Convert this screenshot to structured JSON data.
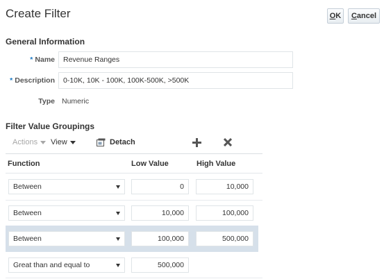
{
  "header": {
    "title": "Create Filter",
    "ok_label": "OK",
    "ok_rest": "K",
    "ok_mnemonic": "O",
    "cancel_mnemonic": "C",
    "cancel_rest": "ancel"
  },
  "general": {
    "section_title": "General Information",
    "name_label": "Name",
    "name_value": "Revenue Ranges",
    "description_label": "Description",
    "description_value": "0-10K, 10K - 100K, 100K-500K, >500K",
    "type_label": "Type",
    "type_value": "Numeric"
  },
  "groupings": {
    "section_title": "Filter Value Groupings",
    "toolbar": {
      "actions_label": "Actions",
      "view_label": "View",
      "detach_label": "Detach"
    },
    "columns": [
      "Function",
      "Low Value",
      "High Value"
    ],
    "rows": [
      {
        "function": "Between",
        "low": "0",
        "high": "10,000",
        "selected": false
      },
      {
        "function": "Between",
        "low": "10,000",
        "high": "100,000",
        "selected": false
      },
      {
        "function": "Between",
        "low": "100,000",
        "high": "500,000",
        "selected": true
      },
      {
        "function": "Great than and equal to",
        "low": "500,000",
        "high": "",
        "selected": false
      }
    ]
  },
  "colors": {
    "required_marker": "#1a78c2",
    "selected_row": "#d6e0ea"
  }
}
